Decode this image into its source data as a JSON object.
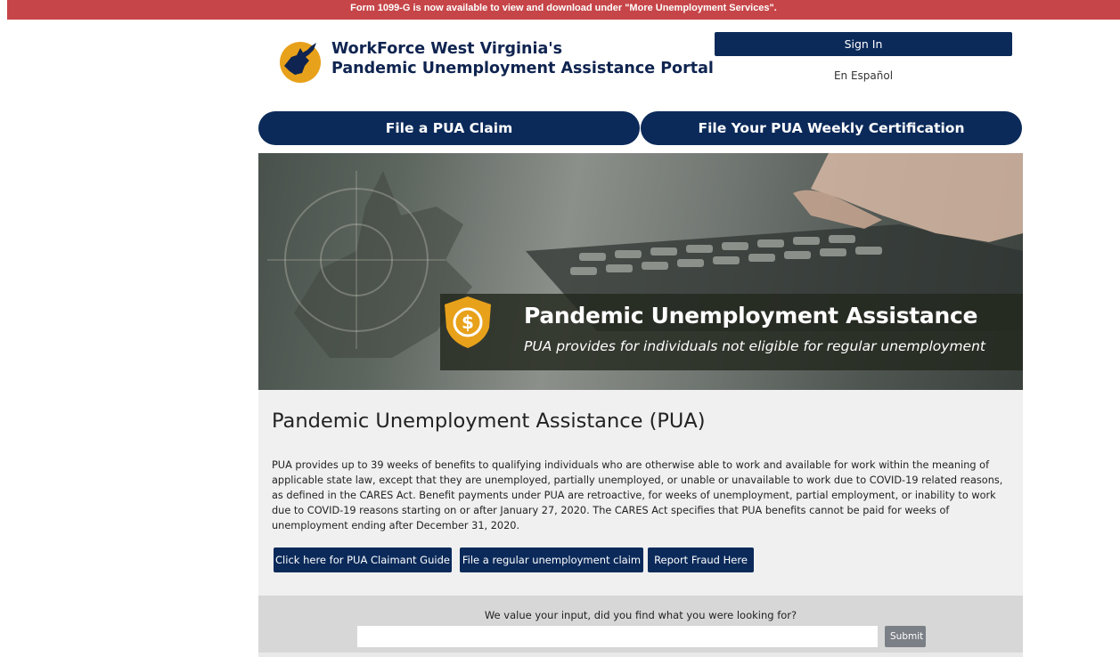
{
  "banner": {
    "text": "Form 1099-G is now available to view and download under \"More Unemployment Services\"."
  },
  "header": {
    "title_line1": "WorkForce West Virginia's",
    "title_line2": "Pandemic Unemployment Assistance Portal",
    "logo_icon": "wv-state-logo-icon",
    "sign_in_label": "Sign In",
    "language_link": "En Español"
  },
  "actions": {
    "file_claim_label": "File a PUA Claim",
    "weekly_cert_label": "File Your PUA Weekly Certification"
  },
  "hero": {
    "title": "Pandemic Unemployment Assistance",
    "subtitle": "PUA provides for individuals not eligible for regular unemployment",
    "icon": "dollar-shield-icon"
  },
  "main": {
    "heading": "Pandemic Unemployment Assistance (PUA)",
    "body": "PUA provides up to 39 weeks of benefits to qualifying individuals who are otherwise able to work and available for work within the meaning of applicable state law, except that they are unemployed, partially unemployed, or unable or unavailable to work due to COVID-19 related reasons, as defined in the CARES Act. Benefit payments under PUA are retroactive, for weeks of unemployment, partial employment, or inability to work due to COVID-19 reasons starting on or after January 27, 2020. The CARES Act specifies that PUA benefits cannot be paid for weeks of unemployment ending after December 31, 2020.",
    "buttons": [
      "Click here for PUA Claimant Guide",
      "File a regular unemployment claim",
      "Report Fraud Here"
    ]
  },
  "feedback": {
    "question": "We value your input, did you find what you were looking for?",
    "input_value": "",
    "submit_label": "Submit"
  },
  "colors": {
    "navy": "#0b2a5a",
    "banner_red": "#c64548",
    "gold": "#e8a11a",
    "panel_gray": "#f0f0f0"
  }
}
